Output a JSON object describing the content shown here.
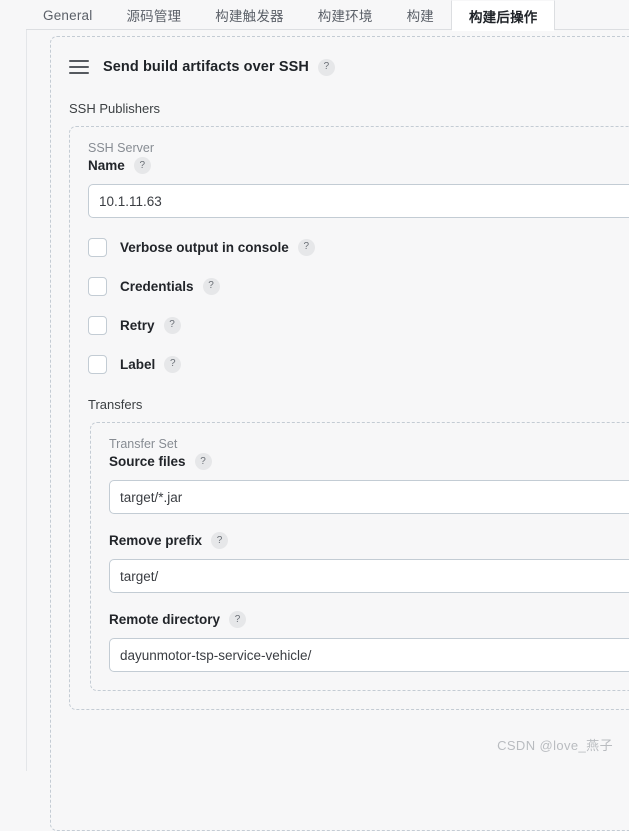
{
  "tabs": [
    {
      "label": "General",
      "active": false
    },
    {
      "label": "源码管理",
      "active": false
    },
    {
      "label": "构建触发器",
      "active": false
    },
    {
      "label": "构建环境",
      "active": false
    },
    {
      "label": "构建",
      "active": false
    },
    {
      "label": "构建后操作",
      "active": true
    }
  ],
  "block": {
    "title": "Send build artifacts over SSH",
    "help": "?",
    "drag_handle": "drag-handle-icon"
  },
  "publishers": {
    "section_label": "SSH Publishers",
    "server": {
      "sub_label": "SSH Server",
      "name_label": "Name",
      "name_help": "?",
      "name_value": "10.1.11.63"
    },
    "checkboxes": [
      {
        "label": "Verbose output in console",
        "help": "?",
        "checked": false
      },
      {
        "label": "Credentials",
        "help": "?",
        "checked": false
      },
      {
        "label": "Retry",
        "help": "?",
        "checked": false
      },
      {
        "label": "Label",
        "help": "?",
        "checked": false
      }
    ]
  },
  "transfers": {
    "section_label": "Transfers",
    "transfer_set": {
      "sub_label": "Transfer Set",
      "source_files_label": "Source files",
      "source_files_help": "?",
      "source_files_value": "target/*.jar",
      "remove_prefix_label": "Remove prefix",
      "remove_prefix_help": "?",
      "remove_prefix_value": "target/",
      "remote_directory_label": "Remote directory",
      "remote_directory_help": "?",
      "remote_directory_value": "dayunmotor-tsp-service-vehicle/"
    }
  },
  "watermark": "CSDN @love_燕子",
  "colors": {
    "page_bg": "#f7f7f8",
    "panel_border": "#c4ccd4",
    "input_border": "#c3ccd4",
    "text": "#22252a",
    "muted_text": "#878c93",
    "help_bg": "#e6e7e9"
  }
}
